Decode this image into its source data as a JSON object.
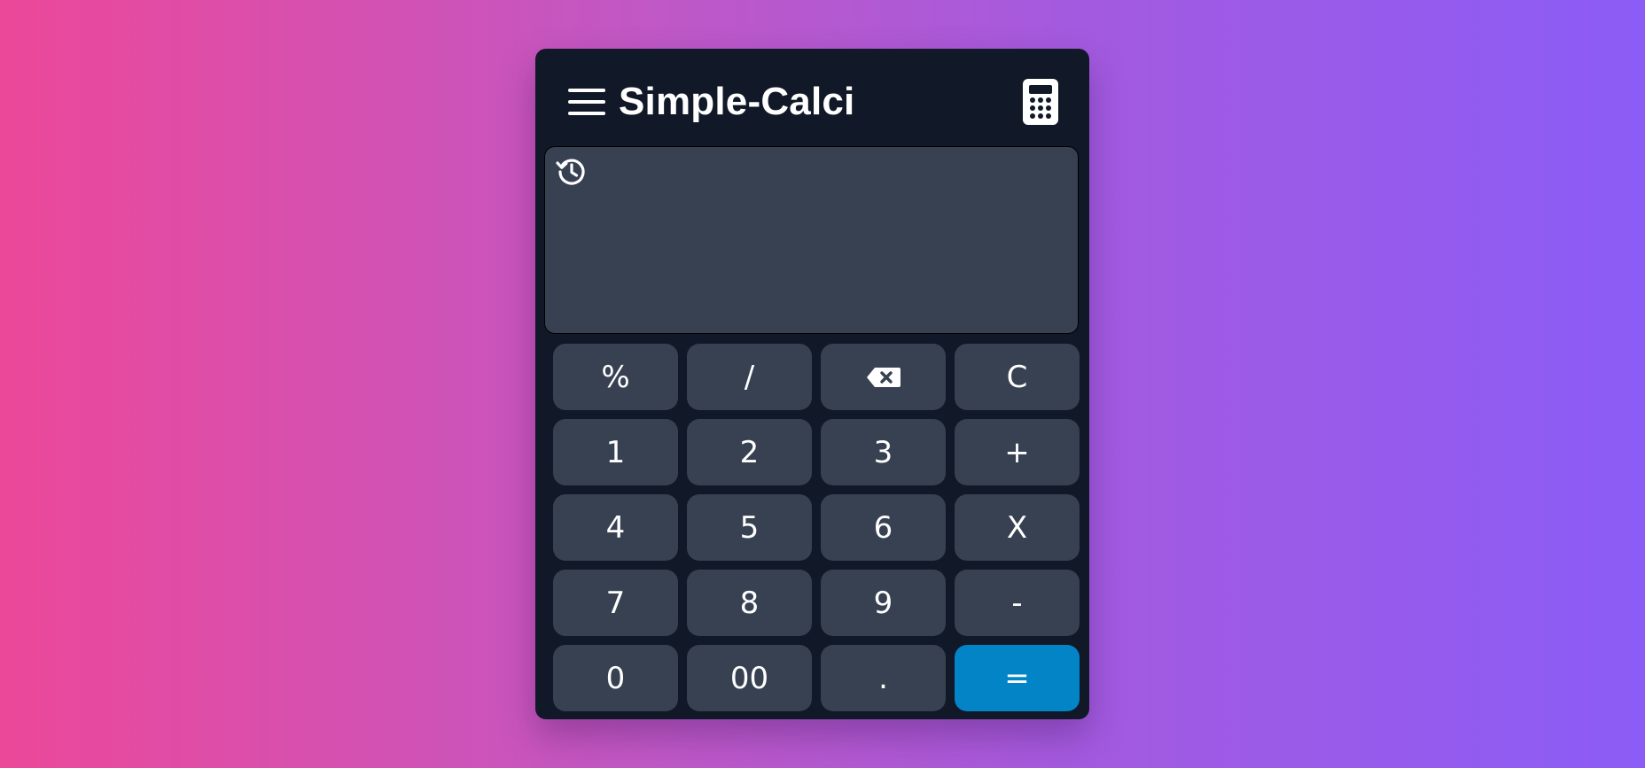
{
  "app": {
    "title": "Simple-Calci",
    "menu_icon": "hamburger-menu-icon",
    "logo_icon": "calculator-icon"
  },
  "display": {
    "history_icon": "history-icon",
    "value": ""
  },
  "keys": [
    {
      "label": "%",
      "name": "percent-button"
    },
    {
      "label": "/",
      "name": "divide-button"
    },
    {
      "label": "",
      "name": "backspace-button",
      "icon": "backspace-icon"
    },
    {
      "label": "C",
      "name": "clear-button"
    },
    {
      "label": "1",
      "name": "digit-1-button"
    },
    {
      "label": "2",
      "name": "digit-2-button"
    },
    {
      "label": "3",
      "name": "digit-3-button"
    },
    {
      "label": "+",
      "name": "add-button"
    },
    {
      "label": "4",
      "name": "digit-4-button"
    },
    {
      "label": "5",
      "name": "digit-5-button"
    },
    {
      "label": "6",
      "name": "digit-6-button"
    },
    {
      "label": "X",
      "name": "multiply-button"
    },
    {
      "label": "7",
      "name": "digit-7-button"
    },
    {
      "label": "8",
      "name": "digit-8-button"
    },
    {
      "label": "9",
      "name": "digit-9-button"
    },
    {
      "label": "-",
      "name": "subtract-button"
    },
    {
      "label": "0",
      "name": "digit-0-button"
    },
    {
      "label": "00",
      "name": "double-zero-button"
    },
    {
      "label": ".",
      "name": "decimal-button"
    },
    {
      "label": "=",
      "name": "equals-button"
    }
  ],
  "colors": {
    "background_gradient_start": "#ec4899",
    "background_gradient_end": "#8b5cf6",
    "panel": "#111827",
    "key": "#374151",
    "equals_key": "#0284c7",
    "text": "#ffffff"
  }
}
